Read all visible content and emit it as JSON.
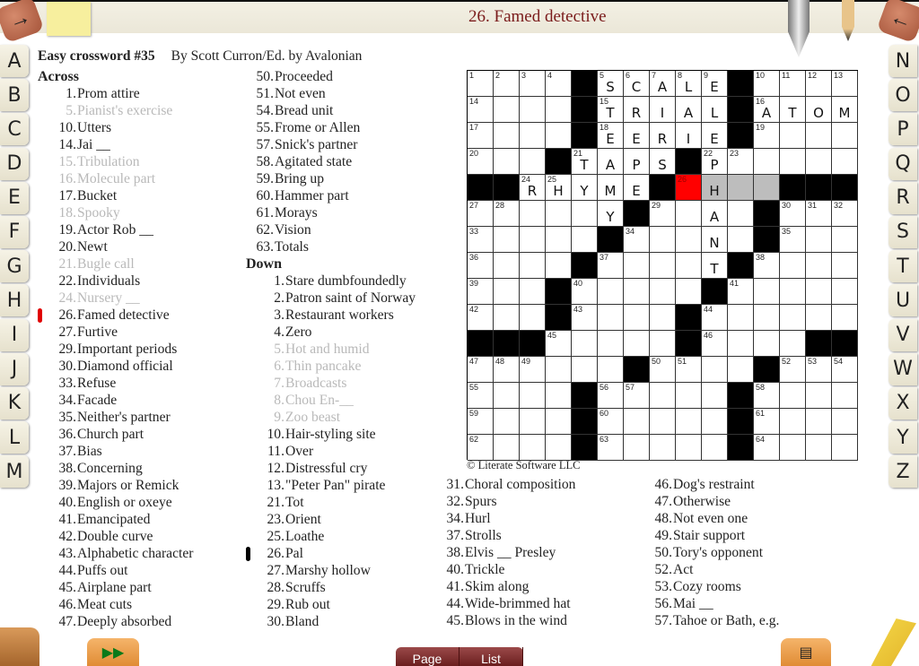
{
  "topbar": {
    "current_clue": "26. Famed detective",
    "left_button_icon": "right-arrow",
    "right_button_icon": "left-arrow",
    "left_arrow": "→",
    "right_arrow": "←"
  },
  "letters_left": [
    "A",
    "B",
    "C",
    "D",
    "E",
    "F",
    "G",
    "H",
    "I",
    "J",
    "K",
    "L",
    "M"
  ],
  "letters_right": [
    "N",
    "O",
    "P",
    "Q",
    "R",
    "S",
    "T",
    "U",
    "V",
    "W",
    "X",
    "Y",
    "Z"
  ],
  "header": {
    "title": "Easy crossword #35",
    "byline": "By Scott Curron/Ed. by Avalonian"
  },
  "across_heading": "Across",
  "down_heading": "Down",
  "across": [
    {
      "n": "1.",
      "t": "Prom attire",
      "done": false
    },
    {
      "n": "5.",
      "t": "Pianist's exercise",
      "done": true
    },
    {
      "n": "10.",
      "t": "Utters",
      "done": false
    },
    {
      "n": "14.",
      "t": "Jai __",
      "done": false
    },
    {
      "n": "15.",
      "t": "Tribulation",
      "done": true
    },
    {
      "n": "16.",
      "t": "Molecule part",
      "done": true
    },
    {
      "n": "17.",
      "t": "Bucket",
      "done": false
    },
    {
      "n": "18.",
      "t": "Spooky",
      "done": true
    },
    {
      "n": "19.",
      "t": "Actor Rob __",
      "done": false
    },
    {
      "n": "20.",
      "t": "Newt",
      "done": false
    },
    {
      "n": "21.",
      "t": "Bugle call",
      "done": true
    },
    {
      "n": "22.",
      "t": "Individuals",
      "done": false
    },
    {
      "n": "24.",
      "t": "Nursery __",
      "done": true
    },
    {
      "n": "26.",
      "t": "Famed detective",
      "done": false,
      "active": true
    },
    {
      "n": "27.",
      "t": "Furtive",
      "done": false
    },
    {
      "n": "29.",
      "t": "Important periods",
      "done": false
    },
    {
      "n": "30.",
      "t": "Diamond official",
      "done": false
    },
    {
      "n": "33.",
      "t": "Refuse",
      "done": false
    },
    {
      "n": "34.",
      "t": "Facade",
      "done": false
    },
    {
      "n": "35.",
      "t": "Neither's partner",
      "done": false
    },
    {
      "n": "36.",
      "t": "Church part",
      "done": false
    },
    {
      "n": "37.",
      "t": "Bias",
      "done": false
    },
    {
      "n": "38.",
      "t": "Concerning",
      "done": false
    },
    {
      "n": "39.",
      "t": "Majors or Remick",
      "done": false
    },
    {
      "n": "40.",
      "t": "English or oxeye",
      "done": false
    },
    {
      "n": "41.",
      "t": "Emancipated",
      "done": false
    },
    {
      "n": "42.",
      "t": "Double curve",
      "done": false
    },
    {
      "n": "43.",
      "t": "Alphabetic character",
      "done": false
    },
    {
      "n": "44.",
      "t": "Puffs out",
      "done": false
    },
    {
      "n": "45.",
      "t": "Airplane part",
      "done": false
    },
    {
      "n": "46.",
      "t": "Meat cuts",
      "done": false
    },
    {
      "n": "47.",
      "t": "Deeply absorbed",
      "done": false
    },
    {
      "n": "50.",
      "t": "Proceeded",
      "done": false
    },
    {
      "n": "51.",
      "t": "Not even",
      "done": false
    },
    {
      "n": "54.",
      "t": "Bread unit",
      "done": false
    },
    {
      "n": "55.",
      "t": "Frome or Allen",
      "done": false
    },
    {
      "n": "57.",
      "t": "Snick's partner",
      "done": false
    },
    {
      "n": "58.",
      "t": "Agitated state",
      "done": false
    },
    {
      "n": "59.",
      "t": "Bring up",
      "done": false
    },
    {
      "n": "60.",
      "t": "Hammer part",
      "done": false
    },
    {
      "n": "61.",
      "t": "Morays",
      "done": false
    },
    {
      "n": "62.",
      "t": "Vision",
      "done": false
    },
    {
      "n": "63.",
      "t": "Totals",
      "done": false
    }
  ],
  "down": [
    {
      "n": "1.",
      "t": "Stare dumbfoundedly",
      "done": false
    },
    {
      "n": "2.",
      "t": "Patron saint of Norway",
      "done": false
    },
    {
      "n": "3.",
      "t": "Restaurant workers",
      "done": false
    },
    {
      "n": "4.",
      "t": "Zero",
      "done": false
    },
    {
      "n": "5.",
      "t": "Hot and humid",
      "done": true
    },
    {
      "n": "6.",
      "t": "Thin pancake",
      "done": true
    },
    {
      "n": "7.",
      "t": "Broadcasts",
      "done": true
    },
    {
      "n": "8.",
      "t": "Chou En-__",
      "done": true
    },
    {
      "n": "9.",
      "t": "Zoo beast",
      "done": true
    },
    {
      "n": "10.",
      "t": "Hair-styling site",
      "done": false
    },
    {
      "n": "11.",
      "t": "Over",
      "done": false
    },
    {
      "n": "12.",
      "t": "Distressful cry",
      "done": false
    },
    {
      "n": "13.",
      "t": "\"Peter Pan\" pirate",
      "done": false
    },
    {
      "n": "21.",
      "t": "Tot",
      "done": false
    },
    {
      "n": "23.",
      "t": "Orient",
      "done": false
    },
    {
      "n": "25.",
      "t": "Loathe",
      "done": false
    },
    {
      "n": "26.",
      "t": "Pal",
      "done": false,
      "secondary": true
    },
    {
      "n": "27.",
      "t": "Marshy hollow",
      "done": false
    },
    {
      "n": "28.",
      "t": "Scruffs",
      "done": false
    },
    {
      "n": "29.",
      "t": "Rub out",
      "done": false
    },
    {
      "n": "30.",
      "t": "Bland",
      "done": false
    },
    {
      "n": "31.",
      "t": "Choral composition",
      "done": false
    },
    {
      "n": "32.",
      "t": "Spurs",
      "done": false
    },
    {
      "n": "34.",
      "t": "Hurl",
      "done": false
    },
    {
      "n": "37.",
      "t": "Strolls",
      "done": false
    },
    {
      "n": "38.",
      "t": "Elvis __ Presley",
      "done": false
    },
    {
      "n": "40.",
      "t": "Trickle",
      "done": false
    },
    {
      "n": "41.",
      "t": "Skim along",
      "done": false
    },
    {
      "n": "44.",
      "t": "Wide-brimmed hat",
      "done": false
    },
    {
      "n": "45.",
      "t": "Blows in the wind",
      "done": false
    },
    {
      "n": "46.",
      "t": "Dog's restraint",
      "done": false
    },
    {
      "n": "47.",
      "t": "Otherwise",
      "done": false
    },
    {
      "n": "48.",
      "t": "Not even one",
      "done": false
    },
    {
      "n": "49.",
      "t": "Stair support",
      "done": false
    },
    {
      "n": "50.",
      "t": "Tory's opponent",
      "done": false
    },
    {
      "n": "52.",
      "t": "Act",
      "done": false
    },
    {
      "n": "53.",
      "t": "Cozy rooms",
      "done": false
    },
    {
      "n": "56.",
      "t": "Mai __",
      "done": false
    },
    {
      "n": "57.",
      "t": "Tahoe or Bath, e.g.",
      "done": false
    }
  ],
  "grid": {
    "pattern": [
      "....#.....#....",
      "....#.....#....",
      "....#.....#....",
      "...#....#......",
      "##.....#....###",
      "......#....#...",
      ".....#.....#...",
      "....#.....#....",
      "...#.....#.....",
      "...#....#......",
      "###.....#....##",
      "......#....#...",
      "....#.....#....",
      "....#.....#....",
      "....#.....#...."
    ],
    "letters": [
      "     SCALE     ",
      "     TRIAL ATOM",
      "     EERIE     ",
      "    TAPS P     ",
      "  RHYME  H     ",
      "     Y   A     ",
      "         N     ",
      "         T     ",
      "               ",
      "               ",
      "               ",
      "               ",
      "               ",
      "               ",
      "               "
    ],
    "current_cell": [
      4,
      8
    ],
    "highlight_cells": [
      [
        4,
        9
      ],
      [
        4,
        10
      ],
      [
        4,
        11
      ]
    ]
  },
  "copyright": "© Literate Software LLC",
  "bottom": {
    "page_label": "Page",
    "list_label": "List"
  },
  "colors": {
    "current_cell": "#ff0000",
    "highlight": "#bdbdbd",
    "title": "#7a1b1b",
    "active_marker": "#e00000",
    "secondary_marker": "#000000",
    "done_text": "#b9b9b9"
  }
}
